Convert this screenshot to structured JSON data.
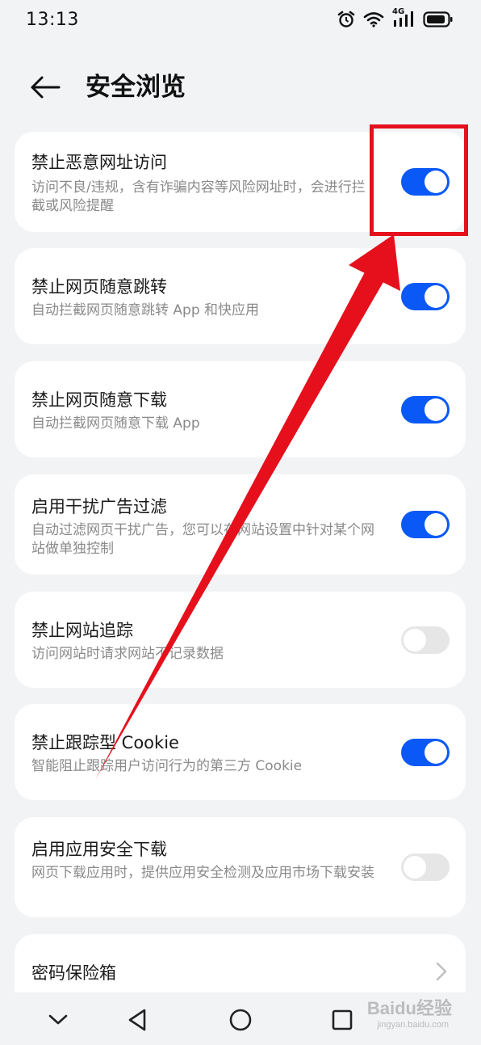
{
  "status_bar": {
    "time": "13:13",
    "network": "4G"
  },
  "header": {
    "title": "安全浏览"
  },
  "settings": [
    {
      "title": "禁止恶意网址访问",
      "desc": "访问不良/违规，含有诈骗内容等风险网址时，会进行拦截或风险提醒",
      "enabled": true
    },
    {
      "title": "禁止网页随意跳转",
      "desc": "自动拦截网页随意跳转 App 和快应用",
      "enabled": true
    },
    {
      "title": "禁止网页随意下载",
      "desc": "自动拦截网页随意下载 App",
      "enabled": true
    },
    {
      "title": "启用干扰广告过滤",
      "desc": "自动过滤网页干扰广告，您可以在网站设置中针对某个网站做单独控制",
      "enabled": true
    },
    {
      "title": "禁止网站追踪",
      "desc": "访问网站时请求网站不记录数据",
      "enabled": false
    },
    {
      "title": "禁止跟踪型 Cookie",
      "desc": "智能阻止跟踪用户访问行为的第三方 Cookie",
      "enabled": true
    },
    {
      "title": "启用应用安全下载",
      "desc": "网页下载应用时，提供应用安全检测及应用市场下载安装",
      "enabled": false
    }
  ],
  "password_vault": {
    "title": "密码保险箱"
  },
  "watermark": {
    "brand": "Baidu经验",
    "url": "jingyan.baidu.com"
  },
  "colors": {
    "toggle_on": "#0a59f7",
    "toggle_off": "#e6e6e6",
    "annotation": "#e5101c",
    "background": "#f1f3f5"
  }
}
